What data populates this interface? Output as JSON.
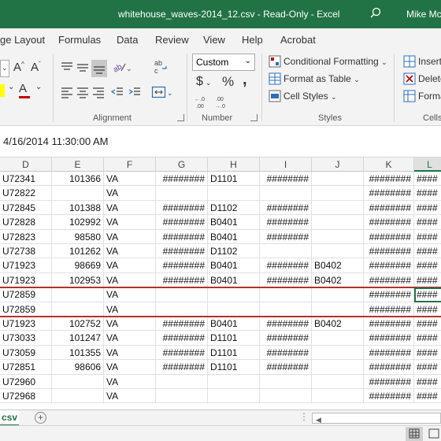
{
  "window": {
    "title": "whitehouse_waves-2014_12.csv  -  Read-Only  -  Excel",
    "user": "Mike Mc"
  },
  "menu": {
    "tabs": [
      "ge Layout",
      "Formulas",
      "Data",
      "Review",
      "View",
      "Help",
      "Acrobat"
    ]
  },
  "ribbon": {
    "alignment_label": "Alignment",
    "number_label": "Number",
    "styles_label": "Styles",
    "cells_label": "Cells",
    "number_format": "Custom",
    "currency_symbol": "$",
    "percent_symbol": "%",
    "comma_symbol": ",",
    "conditional_formatting": "Conditional Formatting",
    "format_as_table": "Format as Table",
    "cell_styles": "Cell Styles",
    "insert": "Insert",
    "delete": "Delete",
    "format": "Format",
    "colors": {
      "font": "#c00000",
      "fill": "#ffff00",
      "accent": "#217346"
    }
  },
  "formula_bar": {
    "value": "4/16/2014  11:30:00 AM"
  },
  "grid": {
    "columns": [
      "D",
      "E",
      "F",
      "G",
      "H",
      "I",
      "J",
      "K",
      "L"
    ],
    "active_column": "L",
    "rows": [
      [
        "U72341",
        "101366",
        "VA",
        "########",
        "D1101",
        "########",
        "",
        "########",
        "####"
      ],
      [
        "U72822",
        "",
        "VA",
        "",
        "",
        "",
        "",
        "########",
        "####"
      ],
      [
        "U72845",
        "101388",
        "VA",
        "########",
        "D1102",
        "########",
        "",
        "########",
        "####"
      ],
      [
        "U72828",
        "102992",
        "VA",
        "########",
        "B0401",
        "########",
        "",
        "########",
        "####"
      ],
      [
        "U72823",
        "98580",
        "VA",
        "########",
        "B0401",
        "########",
        "",
        "########",
        "####"
      ],
      [
        "U72738",
        "101262",
        "VA",
        "########",
        "D1102",
        "",
        "",
        "########",
        "####"
      ],
      [
        "U71923",
        "98669",
        "VA",
        "########",
        "B0401",
        "########",
        "B0402",
        "########",
        "####"
      ],
      [
        "U71923",
        "102953",
        "VA",
        "########",
        "B0401",
        "########",
        "B0402",
        "########",
        "####"
      ],
      [
        "U72859",
        "",
        "VA",
        "",
        "",
        "",
        "",
        "########",
        "####"
      ],
      [
        "U72859",
        "",
        "VA",
        "",
        "",
        "",
        "",
        "########",
        "####"
      ],
      [
        "U71923",
        "102752",
        "VA",
        "########",
        "B0401",
        "########",
        "B0402",
        "########",
        "####"
      ],
      [
        "U73033",
        "101247",
        "VA",
        "########",
        "D1101",
        "########",
        "",
        "########",
        "####"
      ],
      [
        "U73059",
        "101355",
        "VA",
        "########",
        "D1101",
        "########",
        "",
        "########",
        "####"
      ],
      [
        "U72851",
        "98606",
        "VA",
        "########",
        "D1101",
        "########",
        "",
        "########",
        "####"
      ],
      [
        "U72960",
        "",
        "VA",
        "",
        "",
        "",
        "",
        "########",
        "####"
      ],
      [
        "U72968",
        "",
        "VA",
        "",
        "",
        "",
        "",
        "########",
        "####"
      ]
    ]
  },
  "sheets": {
    "active": "csv"
  }
}
